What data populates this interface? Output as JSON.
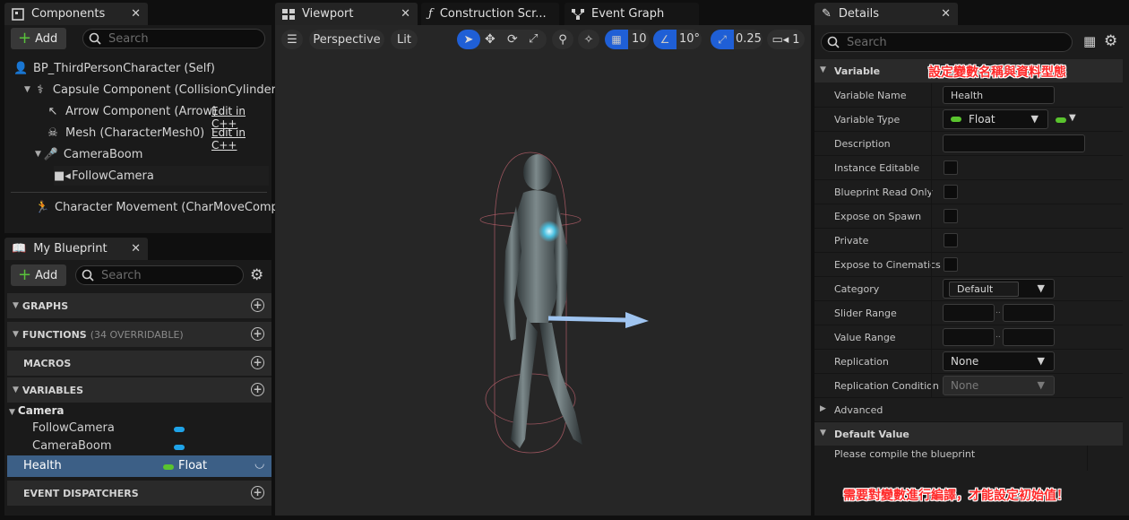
{
  "components_panel": {
    "tab_title": "Components",
    "add_label": "Add",
    "search_placeholder": "Search",
    "tree": [
      {
        "label": "BP_ThirdPersonCharacter (Self)",
        "icon": "person-icon"
      },
      {
        "label": "Capsule Component (CollisionCylinder)",
        "icon": "capsule-icon"
      },
      {
        "label": "Arrow Component (Arrow)",
        "icon": "arrow-icon",
        "link": "Edit in C++"
      },
      {
        "label": "Mesh (CharacterMesh0)",
        "icon": "skeleton-icon",
        "link": "Edit in C++"
      },
      {
        "label": "CameraBoom",
        "icon": "boom-icon"
      },
      {
        "label": "FollowCamera",
        "icon": "camera-icon"
      },
      {
        "label": "Character Movement (CharMoveComp)",
        "icon": "movement-icon"
      }
    ]
  },
  "blueprint_panel": {
    "tab_title": "My Blueprint",
    "add_label": "Add",
    "search_placeholder": "Search",
    "sections": {
      "graphs": "GRAPHS",
      "functions": "FUNCTIONS",
      "functions_sub": "(34 OVERRIDABLE)",
      "macros": "MACROS",
      "variables": "VARIABLES",
      "event_dispatchers": "EVENT DISPATCHERS"
    },
    "category": "Camera",
    "variables": [
      {
        "name": "FollowCamera",
        "type_color": "#1fa3e8"
      },
      {
        "name": "CameraBoom",
        "type_color": "#1fa3e8"
      }
    ],
    "selected_variable": {
      "name": "Health",
      "type": "Float",
      "type_color": "#5ac42e"
    }
  },
  "center_tabs": {
    "viewport": "Viewport",
    "construction": "Construction Scr...",
    "event_graph": "Event Graph"
  },
  "viewport_toolbar": {
    "perspective": "Perspective",
    "lit": "Lit",
    "grid_value": "10",
    "angle_value": "10°",
    "scale_value": "0.25",
    "camera_speed": "1"
  },
  "details_panel": {
    "tab_title": "Details",
    "search_placeholder": "Search",
    "variable_section": "Variable",
    "rows": {
      "variable_name_label": "Variable Name",
      "variable_name_value": "Health",
      "variable_type_label": "Variable Type",
      "variable_type_value": "Float",
      "description_label": "Description",
      "instance_editable_label": "Instance Editable",
      "blueprint_read_only_label": "Blueprint Read Only",
      "expose_on_spawn_label": "Expose on Spawn",
      "private_label": "Private",
      "expose_to_cinematics_label": "Expose to Cinematics",
      "category_label": "Category",
      "category_value": "Default",
      "slider_range_label": "Slider Range",
      "value_range_label": "Value Range",
      "replication_label": "Replication",
      "replication_value": "None",
      "replication_condition_label": "Replication Condition",
      "replication_condition_value": "None"
    },
    "advanced_label": "Advanced",
    "default_value_section": "Default Value",
    "default_value_message": "Please compile the blueprint"
  },
  "annotations": {
    "top": "設定變數名稱與資料型態",
    "bottom": "需要對變數進行編譯，才能設定初始值！"
  }
}
